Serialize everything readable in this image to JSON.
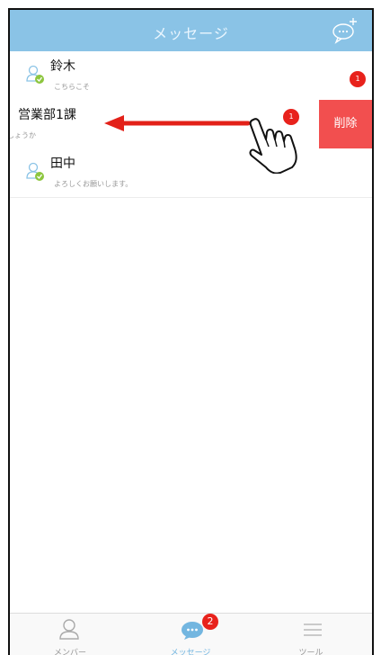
{
  "header": {
    "title": "メッセージ"
  },
  "chats": [
    {
      "name": "鈴木",
      "preview": "こちらこそ",
      "unread": "1"
    },
    {
      "name": "営業部1課",
      "preview": "しょうか",
      "unread": "1",
      "action_label": "削除"
    },
    {
      "name": "田中",
      "preview": "よろしくお願いします。"
    }
  ],
  "tabs": [
    {
      "label": "メンバー",
      "icon": "person-icon"
    },
    {
      "label": "メッセージ",
      "icon": "chat-bubble-icon",
      "badge": "2",
      "active": true
    },
    {
      "label": "ツール",
      "icon": "menu-icon"
    }
  ],
  "colors": {
    "header": "#8ac3e6",
    "badge": "#e8221c",
    "delete": "#f24f4f",
    "active_tab": "#73b6e0",
    "arrow": "#e32119"
  }
}
